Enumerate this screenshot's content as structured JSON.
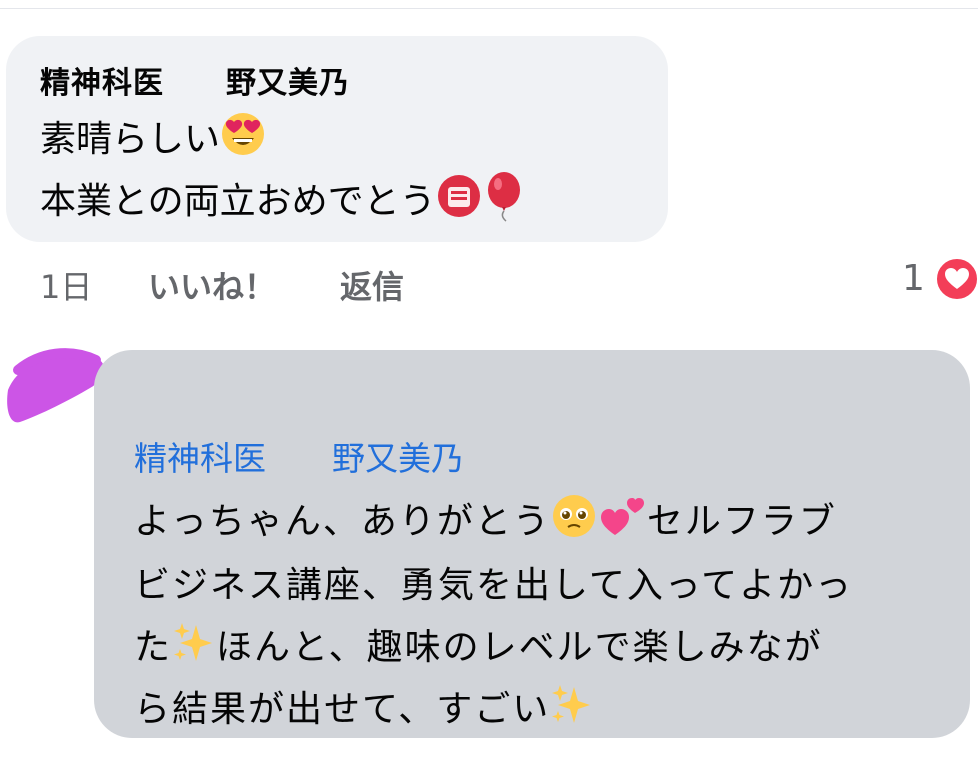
{
  "comment": {
    "author": "精神科医　　野又美乃",
    "lines": [
      "素晴らしい",
      "本業との両立おめでとう"
    ],
    "emojis": [
      "heart-eyes-face",
      "congratulations-kanji-badge",
      "red-balloon"
    ],
    "meta": {
      "time": "1日",
      "like": "いいね！",
      "reply": "返信",
      "reaction_count": "1"
    }
  },
  "reply": {
    "author": "精神科医　　野又美乃",
    "lines": [
      "よっちゃん、ありがとう",
      "セルフラブ",
      "ビジネス講座、勇気を出して入ってよかっ",
      "た",
      "ほんと、趣味のレベルで楽しみなが",
      "ら結果が出せて、すごい"
    ],
    "emojis": [
      "pleading-face",
      "two-hearts",
      "sparkles"
    ]
  },
  "colors": {
    "bubble_light": "#f0f2f5",
    "bubble_reply": "#d1d4d9",
    "author_link": "#216fdb",
    "meta_gray": "#65676b",
    "love_reaction": "#f33e58",
    "redaction_scribble": "#cc55e6"
  }
}
